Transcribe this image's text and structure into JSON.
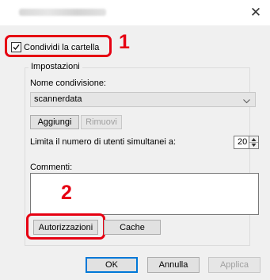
{
  "window": {
    "close_glyph": "✕"
  },
  "share": {
    "checkbox_label": "Condividi la cartella",
    "checked": true
  },
  "settings": {
    "group_label": "Impostazioni",
    "share_name_label": "Nome condivisione:",
    "share_name_value": "scannerdata",
    "add_button": "Aggiungi",
    "remove_button": "Rimuovi",
    "user_limit_label": "Limita il numero di utenti simultanei a:",
    "user_limit_value": "20",
    "comments_label": "Commenti:",
    "comments_value": "",
    "permissions_button": "Autorizzazioni",
    "cache_button": "Cache"
  },
  "footer": {
    "ok": "OK",
    "cancel": "Annulla",
    "apply": "Applica"
  },
  "annotations": {
    "step1": "1",
    "step2": "2",
    "color": "#e60012"
  }
}
